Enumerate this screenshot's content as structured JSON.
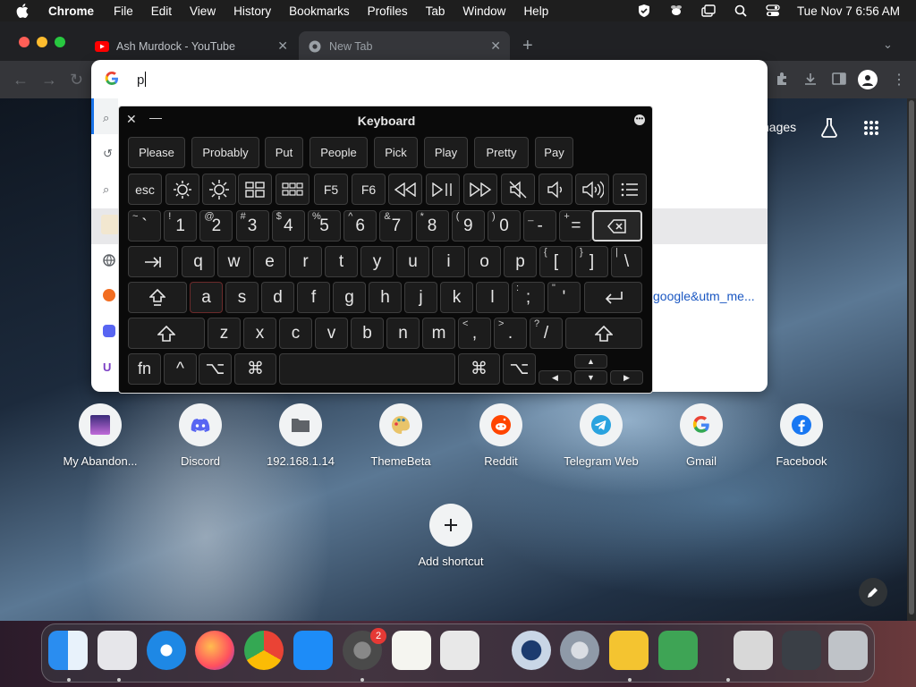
{
  "menubar": {
    "app": "Chrome",
    "items": [
      "File",
      "Edit",
      "View",
      "History",
      "Bookmarks",
      "Profiles",
      "Tab",
      "Window",
      "Help"
    ],
    "clock": "Tue Nov 7  6:56 AM"
  },
  "tabs": [
    {
      "title": "Ash Murdock - YouTube",
      "favicon": "youtube-icon"
    },
    {
      "title": "New Tab",
      "favicon": "chrome-icon"
    }
  ],
  "omnibox": {
    "value": "p"
  },
  "ntp": {
    "images_label": "nages",
    "suggestion_link": "google&utm_me..."
  },
  "keyboard": {
    "title": "Keyboard",
    "predictions": [
      "Please",
      "Probably",
      "Put",
      "People",
      "Pick",
      "Play",
      "Pretty",
      "Pay"
    ],
    "fn_row": [
      "esc",
      "brightness-down-icon",
      "brightness-up-icon",
      "mission-control-icon",
      "launchpad-icon",
      "F5",
      "F6",
      "rewind-icon",
      "play-pause-icon",
      "fast-forward-icon",
      "mute-icon",
      "volume-down-icon",
      "volume-up-icon",
      "list-icon"
    ],
    "row1": [
      {
        "main": "`",
        "shift": "~"
      },
      {
        "main": "1",
        "shift": "!"
      },
      {
        "main": "2",
        "shift": "@"
      },
      {
        "main": "3",
        "shift": "#"
      },
      {
        "main": "4",
        "shift": "$"
      },
      {
        "main": "5",
        "shift": "%"
      },
      {
        "main": "6",
        "shift": "^"
      },
      {
        "main": "7",
        "shift": "&"
      },
      {
        "main": "8",
        "shift": "*"
      },
      {
        "main": "9",
        "shift": "("
      },
      {
        "main": "0",
        "shift": ")"
      },
      {
        "main": "-",
        "shift": "_"
      },
      {
        "main": "=",
        "shift": "+"
      }
    ],
    "row2": [
      "q",
      "w",
      "e",
      "r",
      "t",
      "y",
      "u",
      "i",
      "o",
      "p"
    ],
    "row2_extra": [
      {
        "main": "[",
        "shift": "{"
      },
      {
        "main": "]",
        "shift": "}"
      },
      {
        "main": "\\",
        "shift": "|"
      }
    ],
    "row3": [
      "a",
      "s",
      "d",
      "f",
      "g",
      "h",
      "j",
      "k",
      "l"
    ],
    "row3_extra": [
      {
        "main": ";",
        "shift": ":"
      },
      {
        "main": "'",
        "shift": "\""
      }
    ],
    "row4": [
      "z",
      "x",
      "c",
      "v",
      "b",
      "n",
      "m"
    ],
    "row4_extra": [
      {
        "main": ",",
        "shift": "<"
      },
      {
        "main": ".",
        "shift": ">"
      },
      {
        "main": "/",
        "shift": "?"
      }
    ],
    "bottom": {
      "fn": "fn",
      "ctrl": "^",
      "opt": "⌥",
      "cmd": "⌘"
    }
  },
  "shortcuts": [
    {
      "label": "My Abandon...",
      "icon": "abandonware-icon"
    },
    {
      "label": "Discord",
      "icon": "discord-icon"
    },
    {
      "label": "192.168.1.14",
      "icon": "folder-icon"
    },
    {
      "label": "ThemeBeta",
      "icon": "palette-icon"
    },
    {
      "label": "Reddit",
      "icon": "reddit-icon"
    },
    {
      "label": "Telegram Web",
      "icon": "telegram-icon"
    },
    {
      "label": "Gmail",
      "icon": "google-icon"
    },
    {
      "label": "Facebook",
      "icon": "facebook-icon"
    }
  ],
  "add_shortcut": "Add shortcut",
  "dock": {
    "apps": [
      "finder-icon",
      "launchpad-icon",
      "safari-icon",
      "firefox-icon",
      "chrome-icon",
      "app-store-icon",
      "system-settings-icon",
      "textedit-icon",
      "roblox-icon",
      "quicktime-icon",
      "settings-gear-icon",
      "cyberduck-icon",
      "adguard-icon",
      "preview-icon",
      "screenshot-icon",
      "trash-icon"
    ],
    "settings_badge": "2"
  }
}
